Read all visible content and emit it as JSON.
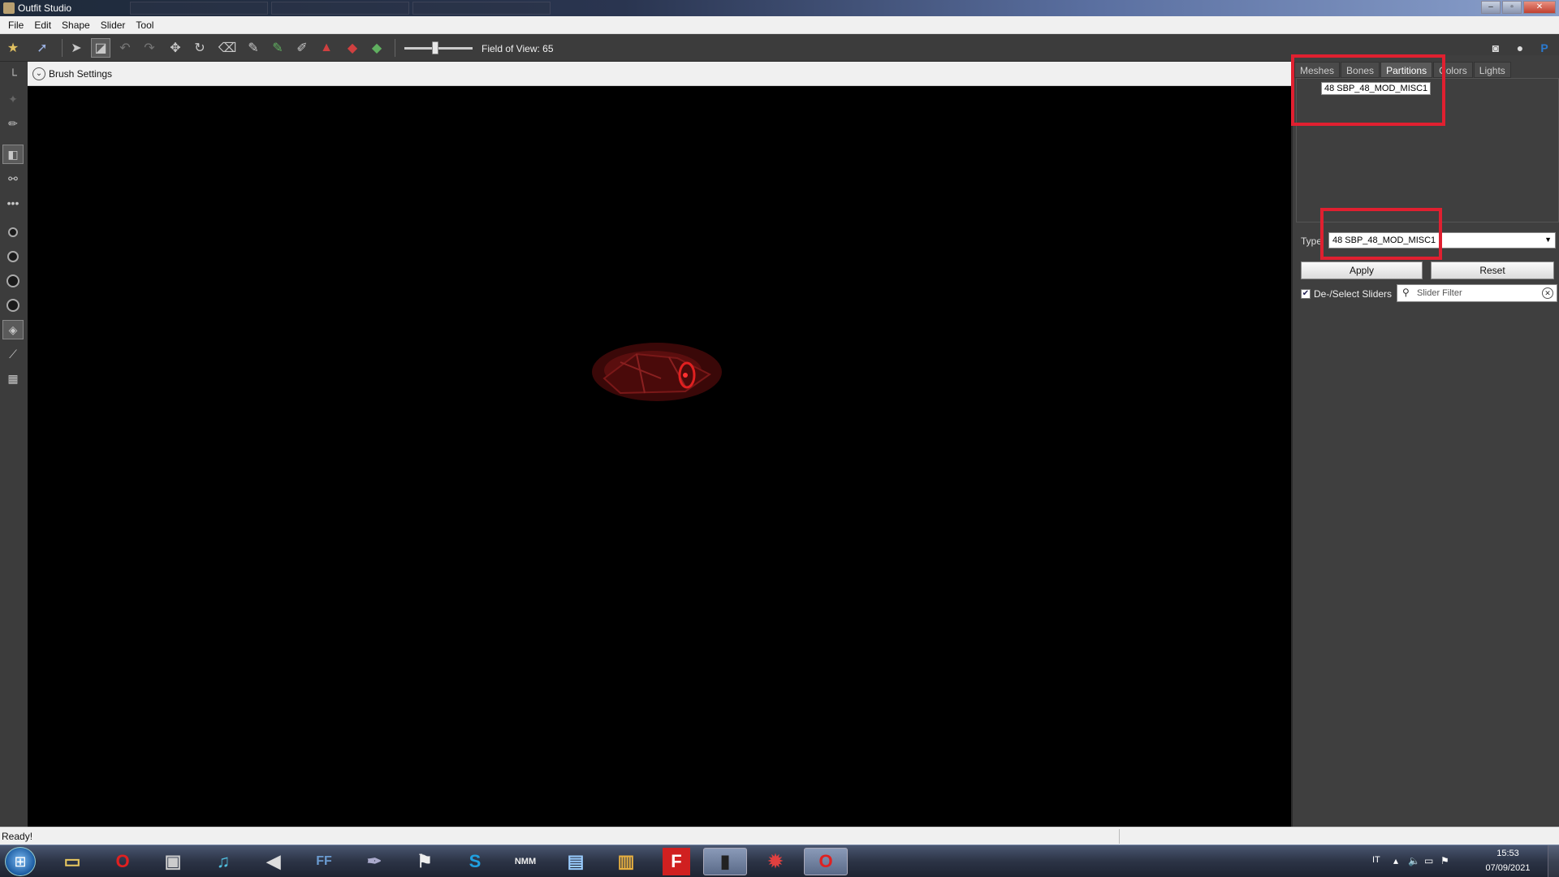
{
  "window": {
    "title": "Outfit Studio"
  },
  "menu": {
    "items": [
      "File",
      "Edit",
      "Shape",
      "Slider",
      "Tool"
    ]
  },
  "toolbar": {
    "fov_label": "Field of View: 65",
    "fov_value": 65
  },
  "brush_settings": {
    "label": "Brush Settings"
  },
  "right_panel": {
    "tabs": [
      "Meshes",
      "Bones",
      "Partitions",
      "Colors",
      "Lights"
    ],
    "active_tab": "Partitions",
    "partition_item": "48 SBP_48_MOD_MISC1",
    "type_label": "Type",
    "type_value": "48 SBP_48_MOD_MISC1",
    "apply_label": "Apply",
    "reset_label": "Reset",
    "deselect_label": "De-/Select Sliders",
    "deselect_checked": true,
    "filter_placeholder": "Slider Filter",
    "highlight_color": "#e02030"
  },
  "status": {
    "text": "Ready!"
  },
  "taskbar": {
    "language": "IT",
    "time": "15:53",
    "date": "07/09/2021"
  }
}
